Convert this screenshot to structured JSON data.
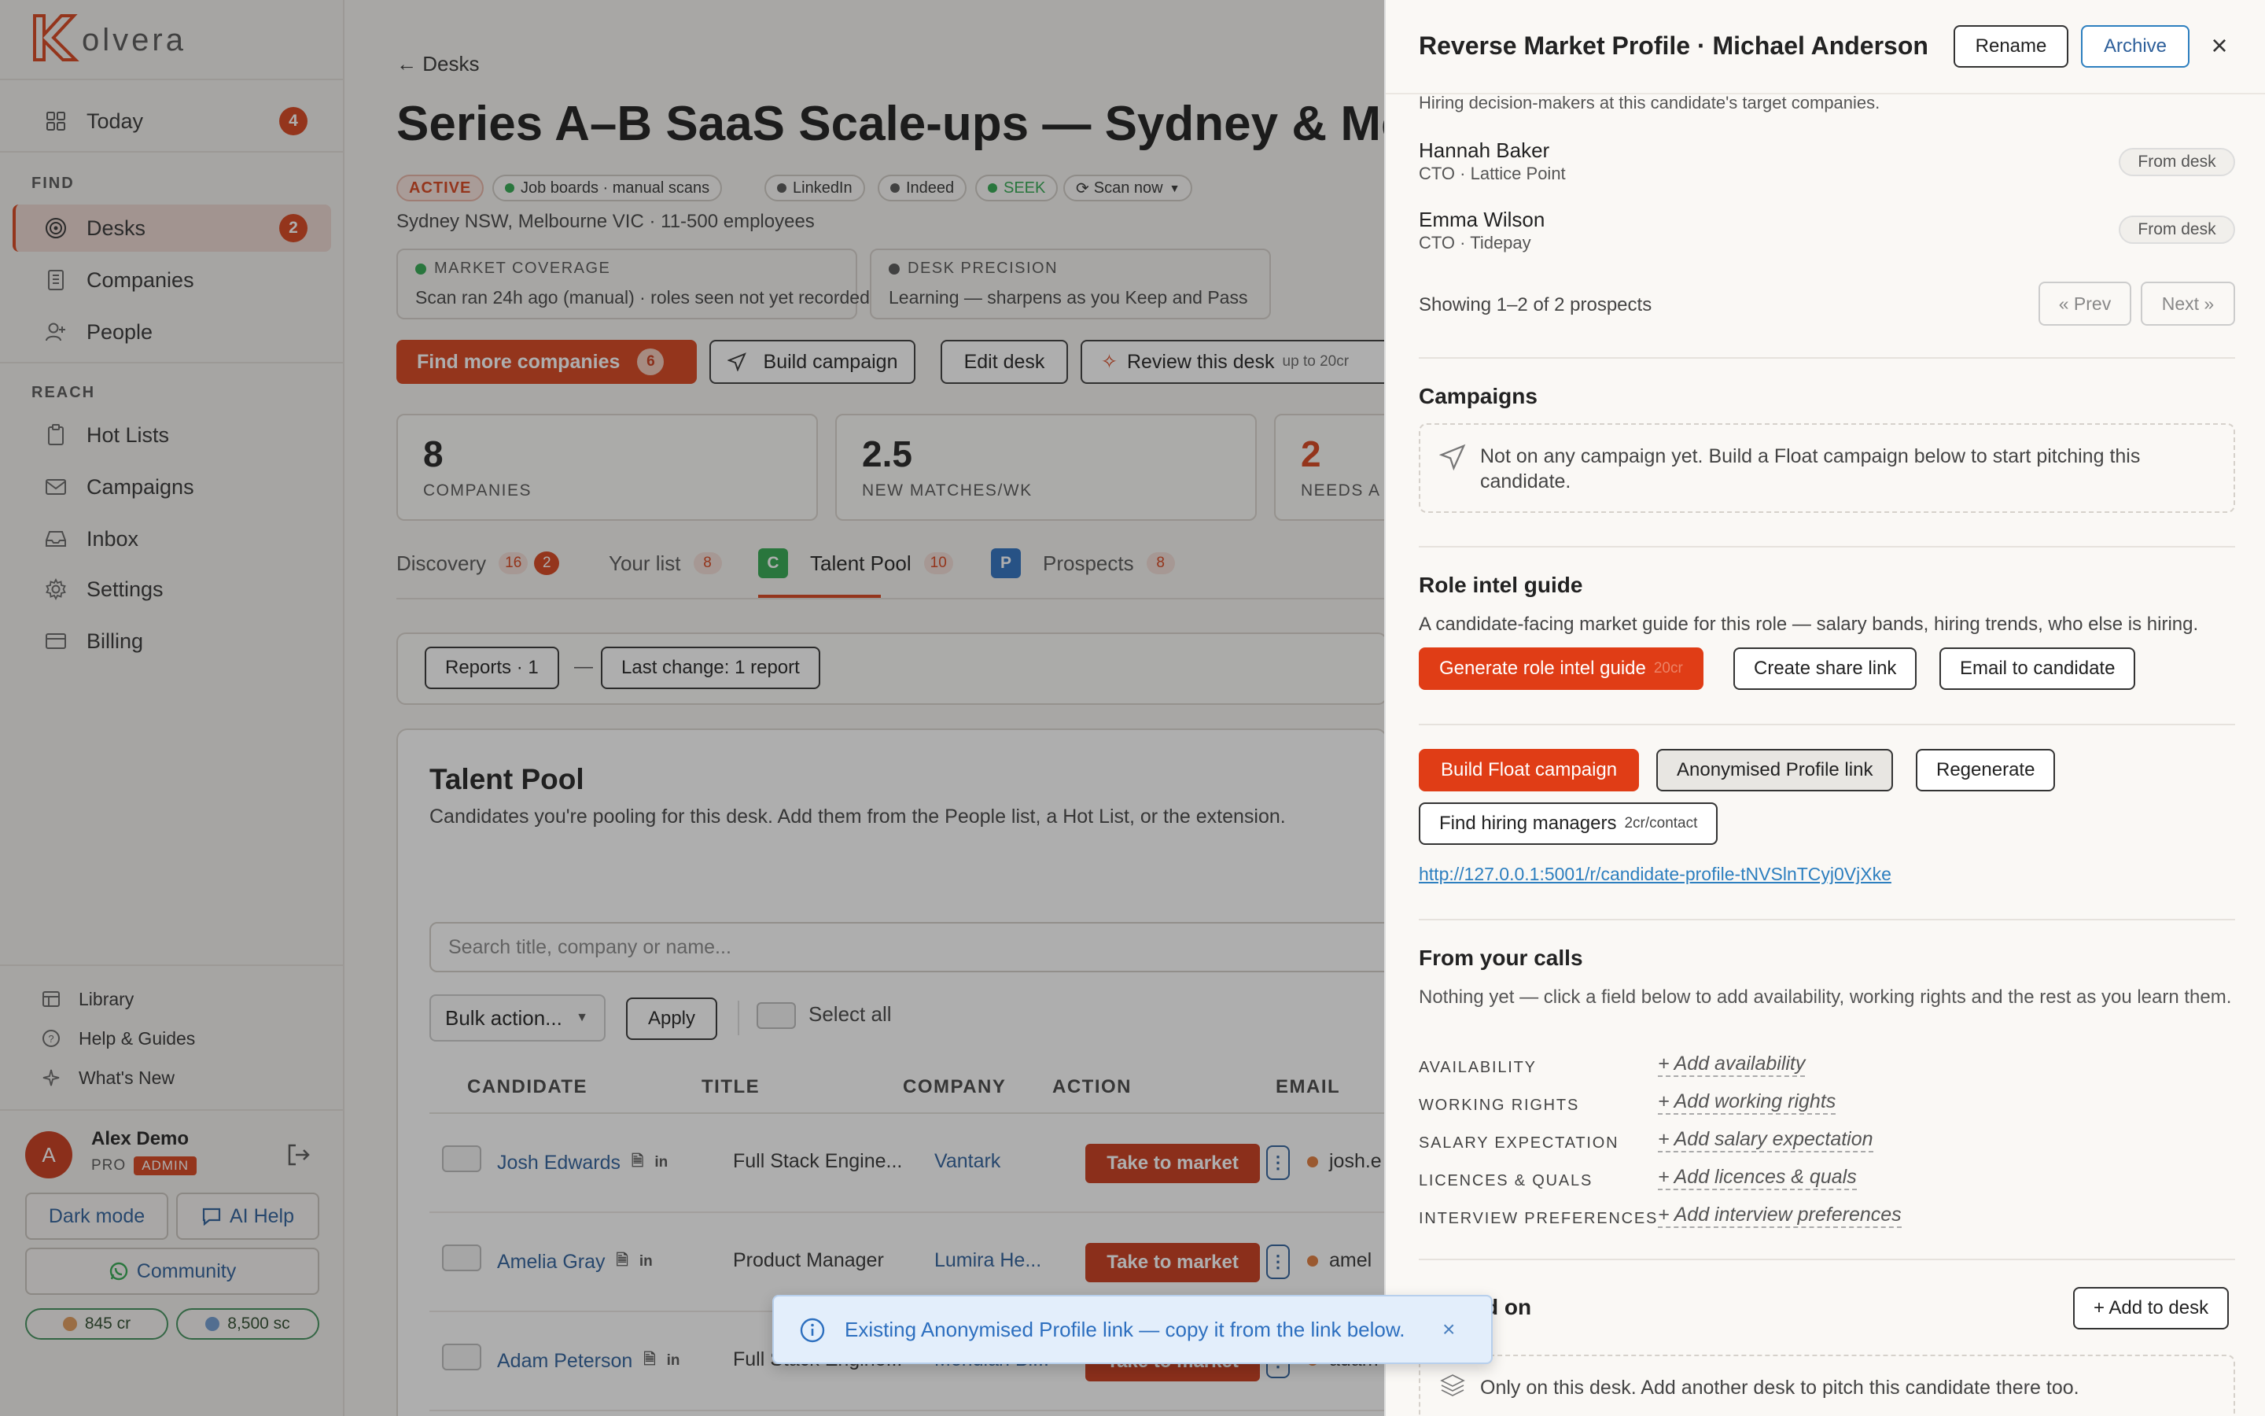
{
  "app": {
    "logo_text": "olvera",
    "brand_color": "#d6431c"
  },
  "sidebar": {
    "today": {
      "label": "Today",
      "badge": "4"
    },
    "find_heading": "FIND",
    "desks": {
      "label": "Desks",
      "badge": "2"
    },
    "companies": "Companies",
    "people": "People",
    "reach_heading": "REACH",
    "hot_lists": "Hot Lists",
    "campaigns": "Campaigns",
    "inbox": "Inbox",
    "settings": "Settings",
    "billing": "Billing",
    "library": "Library",
    "help": "Help & Guides",
    "whats_new": "What's New",
    "user": {
      "initial": "A",
      "name": "Alex Demo",
      "plan": "PRO",
      "role": "ADMIN"
    },
    "dark_mode": "Dark mode",
    "ai_help": "AI Help",
    "community": "Community",
    "credits": "845 cr",
    "search_credits": "8,500 sc"
  },
  "desk": {
    "back": "← Desks",
    "title": "Series A–B SaaS Scale-ups — Sydney & Me",
    "status": "ACTIVE",
    "sources": [
      "Job boards · manual scans",
      "LinkedIn",
      "Indeed",
      "SEEK"
    ],
    "scan_now": "Scan now",
    "subtitle": "Sydney NSW, Melbourne VIC · 11-500 employees",
    "market_coverage": {
      "label": "MARKET COVERAGE",
      "value": "Scan ran 24h ago (manual) · roles seen not yet recorded"
    },
    "desk_precision": {
      "label": "DESK PRECISION",
      "value": "Learning — sharpens as you Keep and Pass"
    },
    "find_more": {
      "label": "Find more companies",
      "count": "6"
    },
    "build_campaign": "Build campaign",
    "edit_desk": "Edit desk",
    "review": {
      "label": "Review this desk",
      "cost": "up to 20cr"
    },
    "stats": [
      {
        "value": "8",
        "caption": "COMPANIES"
      },
      {
        "value": "2.5",
        "caption": "NEW MATCHES/WK"
      },
      {
        "value": "2",
        "caption": "NEEDS A L"
      }
    ],
    "tabs": {
      "discovery": {
        "label": "Discovery",
        "count": "16",
        "new": "2"
      },
      "your_list": {
        "label": "Your list",
        "count": "8"
      },
      "talent_pool": {
        "label": "Talent Pool",
        "count": "10",
        "icon": "C"
      },
      "prospects": {
        "label": "Prospects",
        "count": "8",
        "icon": "P"
      }
    },
    "reports": {
      "label": "Reports · 1",
      "dash": "—",
      "last_change": "Last change:  1 report"
    }
  },
  "talent_pool": {
    "title": "Talent Pool",
    "subtitle": "Candidates you're pooling for this desk. Add them from the People list, a Hot List, or the extension.",
    "search_placeholder": "Search title, company or name...",
    "bulk_action": "Bulk action...",
    "apply": "Apply",
    "select_all": "Select all",
    "columns": [
      "CANDIDATE",
      "TITLE",
      "COMPANY",
      "ACTION",
      "EMAIL"
    ],
    "rows": [
      {
        "name": "Josh Edwards",
        "title": "Full Stack Engine...",
        "company": "Vantark",
        "action": "Take to market",
        "email": "josh.e"
      },
      {
        "name": "Amelia Gray",
        "title": "Product Manager",
        "company": "Lumira He...",
        "action": "Take to market",
        "email": "amel"
      },
      {
        "name": "Adam Peterson",
        "title": "Full Stack Engine...",
        "company": "Meridian Bi...",
        "action": "Take to market",
        "email": "adam"
      }
    ],
    "linkedin_glyph": "in"
  },
  "drawer": {
    "title": "Reverse Market Profile · Michael Anderson",
    "rename": "Rename",
    "archive": "Archive",
    "prospects_intro": "Hiring decision-makers at this candidate's target companies.",
    "prospects": [
      {
        "name": "Hannah Baker",
        "role": "CTO · Lattice Point",
        "tag": "From desk"
      },
      {
        "name": "Emma Wilson",
        "role": "CTO · Tidepay",
        "tag": "From desk"
      }
    ],
    "showing": "Showing 1–2 of 2 prospects",
    "prev": "« Prev",
    "next": "Next »",
    "campaigns_heading": "Campaigns",
    "campaigns_empty": "Not on any campaign yet. Build a Float campaign below to start pitching this candidate.",
    "role_intel_heading": "Role intel guide",
    "role_intel_desc": "A candidate-facing market guide for this role — salary bands, hiring trends, who else is hiring.",
    "generate_guide": "Generate role intel guide",
    "generate_cost": "20cr",
    "create_share": "Create share link",
    "email_candidate": "Email to candidate",
    "build_float": "Build Float campaign",
    "anon_link": "Anonymised Profile link",
    "regenerate": "Regenerate",
    "find_hiring": "Find hiring managers",
    "find_cost": "2cr/contact",
    "profile_url": "http://127.0.0.1:5001/r/candidate-profile-tNVSlnTCyj0VjXke",
    "calls_heading": "From your calls",
    "calls_desc": "Nothing yet — click a field below to add availability, working rights and the rest as you learn them.",
    "fields": [
      {
        "label": "AVAILABILITY",
        "value": "+ Add availability"
      },
      {
        "label": "WORKING RIGHTS",
        "value": "+ Add working rights"
      },
      {
        "label": "SALARY EXPECTATION",
        "value": "+ Add salary expectation"
      },
      {
        "label": "LICENCES & QUALS",
        "value": "+ Add licences & quals"
      },
      {
        "label": "INTERVIEW PREFERENCES",
        "value": "+ Add interview preferences"
      }
    ],
    "pitched_heading": "Pitched on",
    "add_to_desk": "+ Add to desk",
    "pitched_note": "Only on this desk. Add another desk to pitch this candidate there too."
  },
  "toast": {
    "message": "Existing Anonymised Profile link — copy it from the link below.",
    "close": "×"
  }
}
